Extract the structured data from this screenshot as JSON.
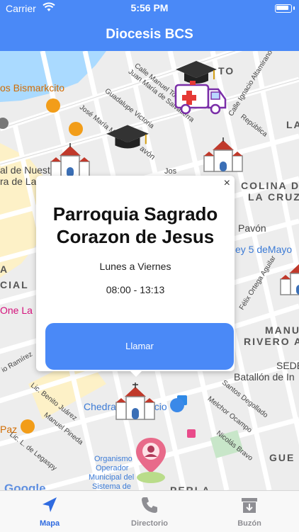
{
  "status_bar": {
    "carrier": "Carrier",
    "time": "5:56 PM"
  },
  "nav": {
    "title": "Diocesis BCS"
  },
  "map": {
    "labels": {
      "bismarkcito": "os Bismarkcito",
      "nuestra": "al de Nuest",
      "ra_de_la": "ra de La",
      "a": "A",
      "cial": "CIAL",
      "one_la": "One La R",
      "colina": "COLINA D",
      "la_cruz": "LA CRUZ",
      "pavon": "Pavón",
      "mayo": "ey 5 deMayo",
      "manu": "MANU",
      "rivero": "RIVERO A",
      "sede": "SEDE",
      "batallon": "Batallón de In",
      "chedraui": "Chedraui",
      "ecio": "ecio",
      "paz": "Paz",
      "organismo": "Organismo",
      "operador": "Operador",
      "municipal": "Municipal del",
      "sistema": "Sistema de",
      "perla": "PERLA",
      "gue": "GUE",
      "la_right": "LA",
      "to": "TO",
      "google": "Google",
      "streets": {
        "manuel_torre": "Calle Manuel Torre",
        "juan_maria": "Juan María de Salvatierra",
        "guadalupe": "Guadalupe Victoria",
        "jose_maria": "José María Morelos",
        "ignacio": "Calle Ignacio Altamirano",
        "republica": "República",
        "felix": "Félix Ortega Aguilar",
        "ramirez": "io Ramírez",
        "benito": "Lic. Benito Juárez",
        "manuel_pineda": "Manuel Pineda",
        "legaspy": "Lic. L. de Legaspy",
        "santos": "Santos Degollado",
        "melchor": "Melchor Ocampo",
        "nicolas": "Nicolás Bravo",
        "jos": "Jos",
        "oo": "avón"
      }
    }
  },
  "popup": {
    "title": "Parroquia Sagrado Corazon de Jesus",
    "days": "Lunes a Viernes",
    "hours": "08:00 - 13:13",
    "call_label": "Llamar",
    "close": "×"
  },
  "tabs": [
    {
      "label": "Mapa",
      "icon": "navigation-arrow-icon",
      "active": true
    },
    {
      "label": "Directorio",
      "icon": "phone-icon",
      "active": false
    },
    {
      "label": "Buzón",
      "icon": "archive-box-icon",
      "active": false
    }
  ],
  "colors": {
    "accent": "#4a89f7",
    "active_tab": "#2f6be0",
    "inactive_tab": "#8e8e93",
    "church_red": "#c0392b"
  }
}
